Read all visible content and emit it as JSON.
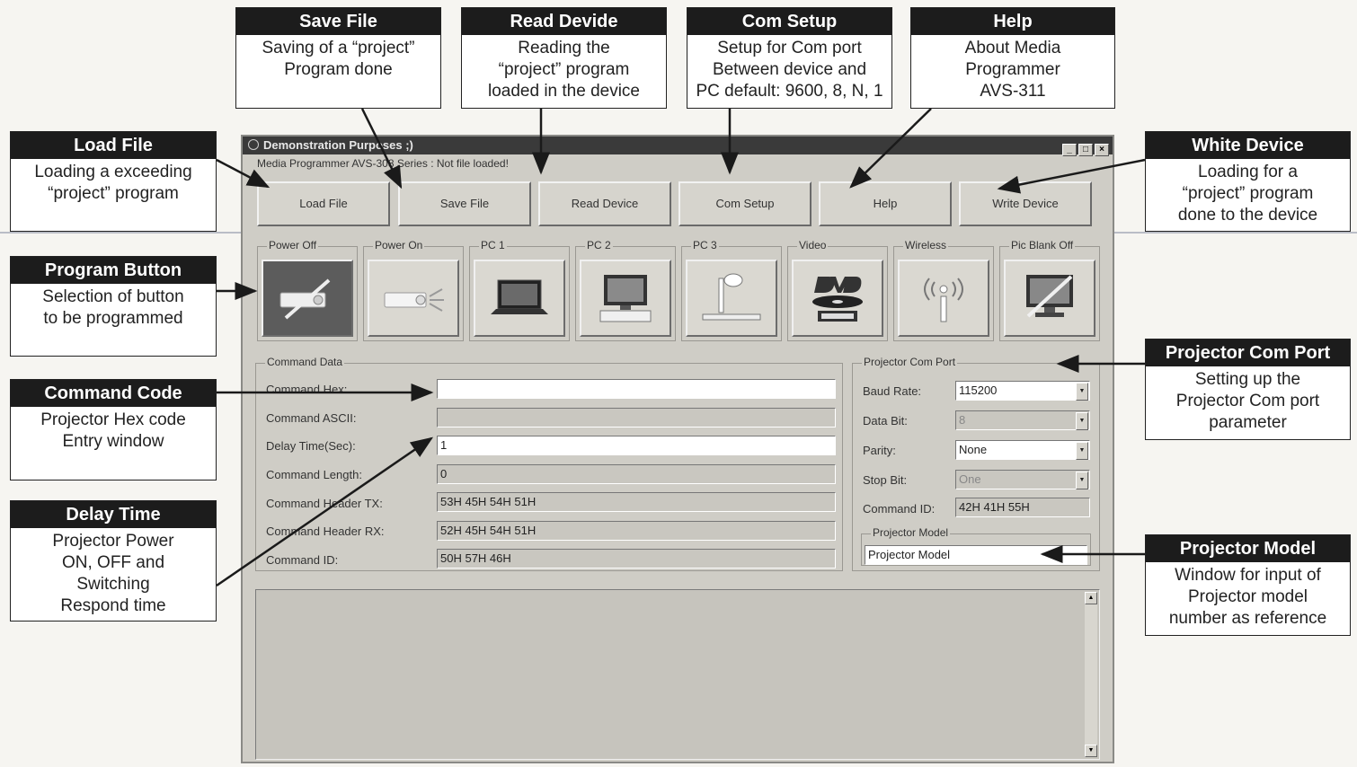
{
  "window": {
    "title": "Demonstration Purposes ;)",
    "status": "Media Programmer AVS-308 Series : Not file loaded!",
    "title_buttons": [
      "_",
      "□",
      "×"
    ]
  },
  "toolbar": [
    "Load File",
    "Save File",
    "Read Device",
    "Com Setup",
    "Help",
    "Write Device"
  ],
  "program_buttons": [
    {
      "label": "Power Off",
      "icon": "projector-off-icon",
      "selected": true
    },
    {
      "label": "Power On",
      "icon": "projector-on-icon",
      "selected": false
    },
    {
      "label": "PC 1",
      "icon": "laptop-icon",
      "selected": false
    },
    {
      "label": "PC 2",
      "icon": "desktop-pc-icon",
      "selected": false
    },
    {
      "label": "PC 3",
      "icon": "document-camera-icon",
      "selected": false
    },
    {
      "label": "Video",
      "icon": "dvd-video-icon",
      "selected": false
    },
    {
      "label": "Wireless",
      "icon": "wireless-icon",
      "selected": false
    },
    {
      "label": "Pic Blank Off",
      "icon": "monitor-off-icon",
      "selected": false
    }
  ],
  "command_data": {
    "title": "Command Data",
    "rows": [
      {
        "label": "Command Hex:",
        "value": "",
        "editable": true
      },
      {
        "label": "Command ASCII:",
        "value": "",
        "editable": false
      },
      {
        "label": "Delay Time(Sec):",
        "value": "1",
        "editable": true
      },
      {
        "label": "Command Length:",
        "value": "0",
        "editable": false
      },
      {
        "label": "Command Header TX:",
        "value": "53H 45H 54H 51H",
        "editable": false
      },
      {
        "label": "Command Header RX:",
        "value": "52H 45H 54H 51H",
        "editable": false
      },
      {
        "label": "Command ID:",
        "value": "50H 57H 46H",
        "editable": false
      }
    ]
  },
  "com_port": {
    "title": "Projector Com Port",
    "baud_label": "Baud Rate:",
    "baud_value": "115200",
    "databit_label": "Data Bit:",
    "databit_value": "8",
    "parity_label": "Parity:",
    "parity_value": "None",
    "stopbit_label": "Stop Bit:",
    "stopbit_value": "One",
    "cmdid_label": "Command ID:",
    "cmdid_value": "42H 41H 55H",
    "model_title": "Projector Model",
    "model_value": "Projector Model"
  },
  "callouts": {
    "save": {
      "title": "Save File",
      "body": "Saving of a “project”\nProgram done"
    },
    "read": {
      "title": "Read Devide",
      "body": "Reading the\n“project” program\nloaded in the device"
    },
    "com": {
      "title": "Com Setup",
      "body": "Setup for Com port\nBetween device and\nPC default: 9600, 8, N, 1"
    },
    "help": {
      "title": "Help",
      "body": "About Media\nProgrammer\nAVS-311"
    },
    "load": {
      "title": "Load File",
      "body": "Loading a exceeding\n“project” program"
    },
    "white": {
      "title": "White Device",
      "body": "Loading for a\n“project” program\ndone to the device"
    },
    "program": {
      "title": "Program Button",
      "body": "Selection of button\nto be programmed"
    },
    "cmdcode": {
      "title": "Command Code",
      "body": "Projector Hex code\nEntry window"
    },
    "delay": {
      "title": "Delay Time",
      "body": "Projector Power\nON, OFF and\nSwitching\nRespond time"
    },
    "pcport": {
      "title": "Projector Com Port",
      "body": "Setting up the\nProjector Com port\nparameter"
    },
    "pmodel": {
      "title": "Projector Model",
      "body": "Window for input of\nProjector model\nnumber as reference"
    }
  }
}
